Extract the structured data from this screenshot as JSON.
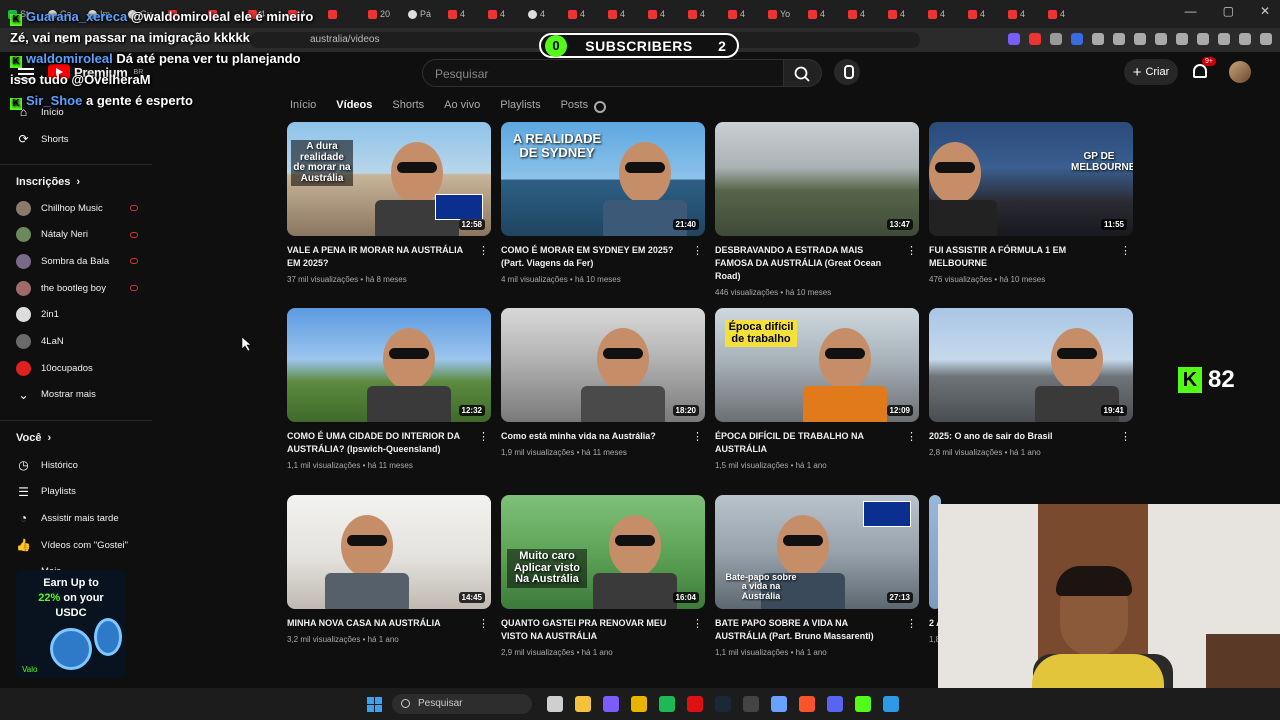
{
  "browser": {
    "tabs": [
      "St",
      "Ca",
      "Im",
      "Gu",
      "",
      "",
      "4",
      "4",
      "",
      "20",
      "Pá",
      "4",
      "4",
      "4",
      "4",
      "4",
      "4",
      "4",
      "4",
      "Yo",
      "4",
      "4",
      "4",
      "4",
      "4",
      "4",
      "4"
    ],
    "url": "australia/videos"
  },
  "masthead": {
    "logo_text": "Premium",
    "region": "BR",
    "search_placeholder": "Pesquisar",
    "create_label": "Criar",
    "notif_count": "9+"
  },
  "sidebar": {
    "top_items": [
      {
        "label": "Início",
        "icon": "home-icon"
      },
      {
        "label": "Shorts",
        "icon": "shorts-icon"
      }
    ],
    "subs_header": "Inscrições",
    "subscriptions": [
      {
        "label": "Chillhop Music",
        "color": "#8a7a6a",
        "live": true
      },
      {
        "label": "Nátaly Neri",
        "color": "#6a8a5a",
        "live": true
      },
      {
        "label": "Sombra da Bala",
        "color": "#7a6a8a",
        "live": true
      },
      {
        "label": "the bootleg boy",
        "color": "#a06a6a",
        "live": true
      },
      {
        "label": "2in1",
        "color": "#dddddd",
        "live": false
      },
      {
        "label": "4LaN",
        "color": "#6a6a6a",
        "live": false
      },
      {
        "label": "10ocupados",
        "color": "#e02020",
        "live": false
      },
      {
        "label": "Mostrar mais",
        "color": "",
        "live": false
      }
    ],
    "you_header": "Você",
    "you_items": [
      {
        "label": "Histórico",
        "icon": "history-icon"
      },
      {
        "label": "Playlists",
        "icon": "playlists-icon"
      },
      {
        "label": "Assistir mais tarde",
        "icon": "watch-later-icon"
      },
      {
        "label": "Vídeos com \"Gostei\"",
        "icon": "like-icon"
      },
      {
        "label": "Mais",
        "icon": "chevron-icon"
      }
    ]
  },
  "channel_tabs": [
    "Início",
    "Vídeos",
    "Shorts",
    "Ao vivo",
    "Playlists",
    "Posts"
  ],
  "videos": [
    {
      "title": "VALE A PENA IR MORAR NA AUSTRÁLIA EM 2025?",
      "meta": "37 mil visualizações • há 8 meses",
      "duration": "12:58",
      "overlay": "A dura realidade de morar na Austrália",
      "bg": "linear-gradient(180deg,#8ec3ea 0%,#b8d6ea 45%,#c9b59a 46%,#8a7660 100%)"
    },
    {
      "title": "COMO É MORAR EM SYDNEY EM 2025? (Part. Viagens da Fer)",
      "meta": "4 mil visualizações • há 10 meses",
      "duration": "21:40",
      "overlay": "A REALIDADE DE SYDNEY",
      "bg": "linear-gradient(180deg,#5ea7df 0%,#8cc3ea 50%,#2d5f86 51%,#1f4560 100%)"
    },
    {
      "title": "DESBRAVANDO A ESTRADA MAIS FAMOSA DA AUSTRÁLIA (Great Ocean Road)",
      "meta": "446 visualizações • há 10 meses",
      "duration": "13:47",
      "overlay": "",
      "bg": "linear-gradient(180deg,#c9cfd3 0%,#aab2b4 40%,#56664a 60%,#3f4a38 100%)"
    },
    {
      "title": "FUI ASSISTIR A FÓRMULA 1 EM MELBOURNE",
      "meta": "476 visualizações • há 10 meses",
      "duration": "11:55",
      "overlay": "GP DE MELBOURNE",
      "bg": "linear-gradient(180deg,#2a4a7a 0%,#3a5f90 40%,#2b2b33 70%,#18181f 100%)"
    },
    {
      "title": "COMO É UMA CIDADE DO INTERIOR DA AUSTRÁLIA? (Ipswich-Queensland)",
      "meta": "1,1 mil visualizações • há 11 meses",
      "duration": "12:32",
      "overlay": "",
      "bg": "linear-gradient(180deg,#5b9ae0 0%,#9cc5ee 45%,#5d8a3f 65%,#3f6a2a 100%)"
    },
    {
      "title": "Como está minha vida na Austrália?",
      "meta": "1,9 mil visualizações • há 11 meses",
      "duration": "18:20",
      "overlay": "",
      "bg": "linear-gradient(180deg,#d8d8d8 0%,#b7b7b7 40%,#7a7a7a 100%)"
    },
    {
      "title": "ÉPOCA DIFÍCIL DE TRABALHO NA AUSTRÁLIA",
      "meta": "1,5 mil visualizações • há 1 ano",
      "duration": "12:09",
      "overlay": "Época difícil de trabalho",
      "bg": "linear-gradient(180deg,#cfd8df 0%,#a8b3ba 45%,#6b6f72 100%)"
    },
    {
      "title": "2025: O ano de sair do Brasil",
      "meta": "2,8 mil visualizações • há 1 ano",
      "duration": "19:41",
      "overlay": "",
      "bg": "linear-gradient(180deg,#a9c6e6 0%,#c6d9ec 45%,#6e7478 60%,#4a4e52 100%)"
    },
    {
      "title": "MINHA NOVA CASA NA AUSTRÁLIA",
      "meta": "3,2 mil visualizações • há 1 ano",
      "duration": "14:45",
      "overlay": "",
      "bg": "linear-gradient(180deg,#f2f2f0 0%,#e4e2de 55%,#bfb9b0 100%)"
    },
    {
      "title": "QUANTO GASTEI PRA RENOVAR MEU VISTO NA AUSTRÁLIA",
      "meta": "2,9 mil visualizações • há 1 ano",
      "duration": "16:04",
      "overlay": "Muito caro Aplicar visto Na Austrália",
      "bg": "linear-gradient(180deg,#7fc07a 0%,#5ea457 50%,#3e7a3a 100%)"
    },
    {
      "title": "BATE PAPO SOBRE A VIDA NA AUSTRÁLIA (Part. Bruno Massarenti)",
      "meta": "1,1 mil visualizações • há 1 ano",
      "duration": "27:13",
      "overlay": "Bate-papo sobre a vida na Austrália",
      "bg": "linear-gradient(180deg,#b9c3cc 0%,#97a2ac 50%,#5c6770 100%)"
    },
    {
      "title": "2 A",
      "meta": "1,8",
      "duration": "",
      "overlay": "",
      "bg": "linear-gradient(180deg,#9ab7d8 0%,#7f9cc0 100%)"
    }
  ],
  "stream": {
    "chat": [
      {
        "user": "Guarana_xereca",
        "badge": "K",
        "msg": "@waldomiroleal ele é mineiro Zé, vai nem passar na imigração kkkkk"
      },
      {
        "user": "waldomiroleal",
        "badge": "K",
        "msg": "Dá até pena ver tu planejando isso tudo @OvelheraM"
      },
      {
        "user": "Sir_Shoe",
        "badge": "K",
        "msg": "a gente é esperto"
      }
    ],
    "subs_goal_current": "0",
    "subs_goal_label": "SUBSCRIBERS",
    "subs_goal_target": "2",
    "viewer_count": "82",
    "ad_lines": [
      "Earn Up to",
      "22% on your",
      "USDC"
    ],
    "ad_highlight": "22%",
    "ad_brand": "Valo"
  },
  "taskbar": {
    "search_placeholder": "Pesquisar",
    "apps": [
      "file-explorer-icon",
      "folder-icon",
      "apps-icon",
      "chrome-icon",
      "spotify-icon",
      "opera-icon",
      "steam-icon",
      "obs-icon",
      "arrow-icon",
      "brave-icon",
      "discord-icon",
      "kick-icon",
      "notepad-icon"
    ]
  },
  "colors": {
    "accent": "#ff0000",
    "kick_green": "#53fc18",
    "bg": "#0f0f0f"
  }
}
